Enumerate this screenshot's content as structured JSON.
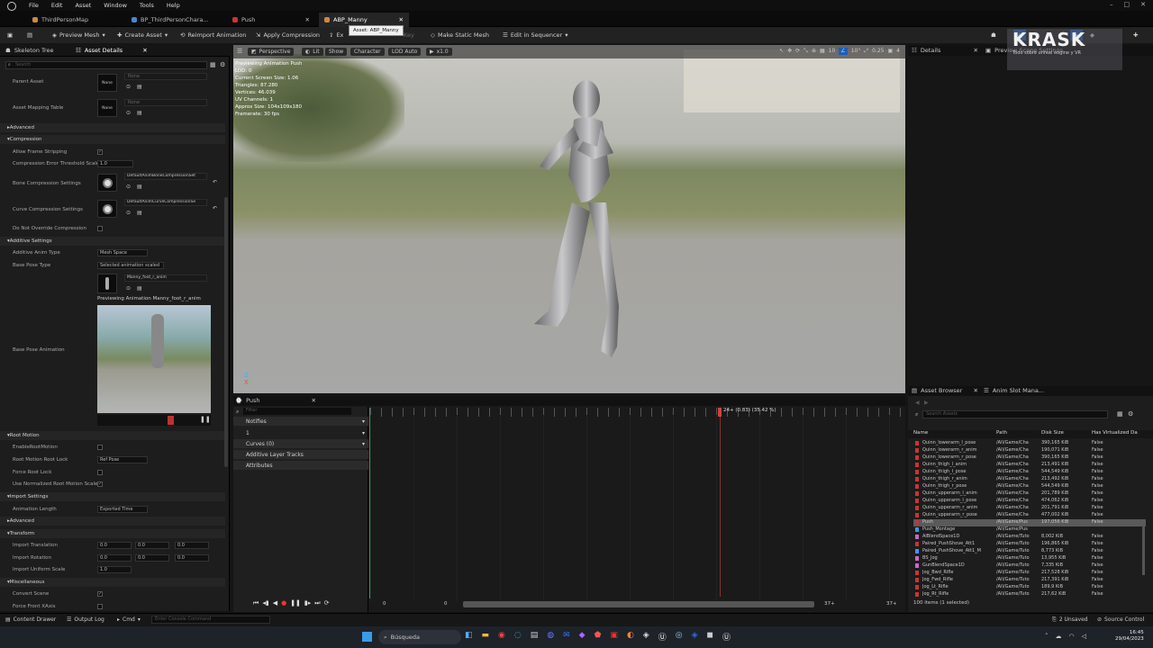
{
  "menu": [
    "File",
    "Edit",
    "Asset",
    "Window",
    "Tools",
    "Help"
  ],
  "tabs": [
    {
      "label": "ThirdPersonMap"
    },
    {
      "label": "BP_ThirdPersonChara..."
    },
    {
      "label": "Push"
    },
    {
      "label": "ABP_Manny"
    }
  ],
  "tooltip": "Asset: ABP_Manny",
  "toolbar": {
    "preview_mesh": "Preview Mesh",
    "create_asset": "Create Asset",
    "reimport": "Reimport Animation",
    "apply_compression": "Apply Compression",
    "export": "Ex",
    "key": "Key",
    "make_static": "Make Static Mesh",
    "edit_sequencer": "Edit in Sequencer"
  },
  "left": {
    "tab1": "Skeleton Tree",
    "tab2": "Asset Details",
    "search": "Search",
    "parent_asset": "Parent Asset",
    "none": "None",
    "asset_mapping": "Asset Mapping Table",
    "advanced": "Advanced",
    "compression": "Compression",
    "allow_frame": "Allow Frame Stripping",
    "compression_error": "Compression Error Threshold Scale",
    "compression_error_val": "1.0",
    "bone_comp": "Bone Compression Settings",
    "bone_comp_val": "DefaultAnimBoneCompressionSet",
    "curve_comp": "Curve Compression Settings",
    "curve_comp_val": "DefaultAnimCurveCompressionSe",
    "no_override": "Do Not Override Compression",
    "additive": "Additive Settings",
    "additive_type": "Additive Anim Type",
    "additive_type_val": "Mesh Space",
    "base_pose_type": "Base Pose Type",
    "base_pose_type_val": "Selected animation scaled",
    "base_anim_val": "Manny_foot_r_anim",
    "previewing": "Previewing Animation Manny_foot_r_anim",
    "base_pose_anim": "Base Pose Animation",
    "root_motion": "Root Motion",
    "enable_root": "EnableRootMotion",
    "root_lock": "Root Motion Root Lock",
    "root_lock_val": "Ref Pose",
    "force_root": "Force Root Lock",
    "use_normalized": "Use Normalized Root Motion Scale",
    "import_settings": "Import Settings",
    "anim_length": "Animation Length",
    "anim_length_val": "Exported Time",
    "advanced2": "Advanced",
    "transform": "Transform",
    "import_translation": "Import Translation",
    "import_rotation": "Import Rotation",
    "import_uniform": "Import Uniform Scale",
    "zero": "0.0",
    "one": "1.0",
    "misc": "Miscellaneous",
    "convert_scene": "Convert Scene",
    "force_front": "Force Front XAxis"
  },
  "viewport": {
    "perspective": "Perspective",
    "lit": "Lit",
    "show": "Show",
    "character": "Character",
    "lod": "LOD Auto",
    "speed": "x1.0",
    "stats": [
      "Previewing Animation Push",
      "LOD: 0",
      "Current Screen Size: 1.06",
      "Triangles: 87.280",
      "Vertices: 46.039",
      "UV Channels: 1",
      "Approx Size: 104x109x180",
      "Framerate: 30 fps"
    ],
    "grid_val": "10",
    "angle_val": "10°",
    "scale_val": "0.25",
    "cam_val": "4"
  },
  "timeline": {
    "tab": "Push",
    "search": "Filter",
    "notifies": "Notifies",
    "notify_track": "1",
    "curves": "Curves (0)",
    "additive_layer": "Additive Layer Tracks",
    "attributes": "Attributes",
    "marker": "24+ (0.83) (35.42 %)",
    "start": "0",
    "start2": "0",
    "end": "37+",
    "end2": "37+"
  },
  "right": {
    "details": "Details",
    "preview": "Preview Scene Settings",
    "logo": "KRASK",
    "logo_sub": "Todo sobre unreal engine y VR"
  },
  "assets": {
    "tab1": "Asset Browser",
    "tab2": "Anim Slot Mana...",
    "search": "Search Assets",
    "cols": [
      "Name",
      "Path",
      "Disk Size",
      "Has Virtualized Da"
    ],
    "rows": [
      [
        "Quinn_lowerarm_l_pose",
        "/All/Game/Cha",
        "390,165 KiB",
        "False",
        "#c33"
      ],
      [
        "Quinn_lowerarm_r_anim",
        "/All/Game/Cha",
        "190,071 KiB",
        "False",
        "#c33"
      ],
      [
        "Quinn_lowerarm_r_pose",
        "/All/Game/Cha",
        "390,165 KiB",
        "False",
        "#c33"
      ],
      [
        "Quinn_thigh_l_anim",
        "/All/Game/Cha",
        "213,491 KiB",
        "False",
        "#c33"
      ],
      [
        "Quinn_thigh_l_pose",
        "/All/Game/Cha",
        "544,549 KiB",
        "False",
        "#c33"
      ],
      [
        "Quinn_thigh_r_anim",
        "/All/Game/Cha",
        "213,492 KiB",
        "False",
        "#c33"
      ],
      [
        "Quinn_thigh_r_pose",
        "/All/Game/Cha",
        "544,549 KiB",
        "False",
        "#c33"
      ],
      [
        "Quinn_upperarm_l_anim",
        "/All/Game/Cha",
        "201,789 KiB",
        "False",
        "#c33"
      ],
      [
        "Quinn_upperarm_l_pose",
        "/All/Game/Cha",
        "474,062 KiB",
        "False",
        "#c33"
      ],
      [
        "Quinn_upperarm_r_anim",
        "/All/Game/Cha",
        "201,791 KiB",
        "False",
        "#c33"
      ],
      [
        "Quinn_upperarm_r_pose",
        "/All/Game/Cha",
        "477,002 KiB",
        "False",
        "#c33"
      ],
      [
        "Push",
        "/All/Game/Pus",
        "197,056 KiB",
        "False",
        "#c33"
      ],
      [
        "Push_Montage",
        "/All/Game/Pus",
        "",
        "",
        "#39f"
      ],
      [
        "AlBlendSpace1D",
        "/All/Game/Tuto",
        "8,002 KiB",
        "False",
        "#c6c"
      ],
      [
        "Paired_PushShove_Att1",
        "/All/Game/Tuto",
        "196,865 KiB",
        "False",
        "#c33"
      ],
      [
        "Paired_PushShove_Att1_M",
        "/All/Game/Tuto",
        "8,773 KiB",
        "False",
        "#39f"
      ],
      [
        "BS_Jog",
        "/All/Game/Tuto",
        "13,955 KiB",
        "False",
        "#c6c"
      ],
      [
        "GunBlendSpace1D",
        "/All/Game/Tuto",
        "7,335 KiB",
        "False",
        "#c6c"
      ],
      [
        "Jog_Bwd_Rifle",
        "/All/Game/Tuto",
        "217,528 KiB",
        "False",
        "#c33"
      ],
      [
        "Jog_Fwd_Rifle",
        "/All/Game/Tuto",
        "217,391 KiB",
        "False",
        "#c33"
      ],
      [
        "Jog_Lt_Rifle",
        "/All/Game/Tuto",
        "189,9 KiB",
        "False",
        "#c33"
      ],
      [
        "Jog_Rt_Rifle",
        "/All/Game/Tuto",
        "217,62 KiB",
        "False",
        "#c33"
      ]
    ],
    "count": "100 items (1 selected)"
  },
  "bottom": {
    "drawer": "Content Drawer",
    "output": "Output Log",
    "cmd": "Cmd",
    "console": "Enter Console Command",
    "unsaved": "2 Unsaved",
    "source": "Source Control"
  },
  "taskbar": {
    "search": "Búsqueda",
    "time": "16:45",
    "date": "29/04/2023"
  }
}
